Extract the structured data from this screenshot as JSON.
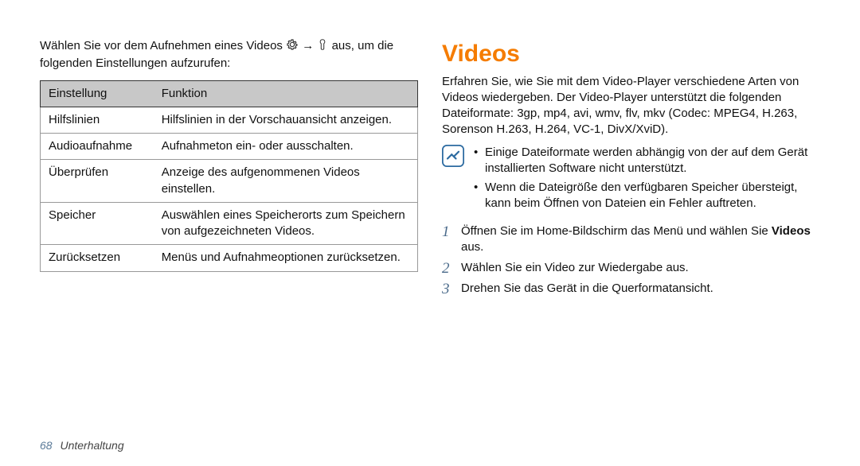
{
  "left": {
    "intro_before": "Wählen Sie vor dem Aufnehmen eines Videos ",
    "intro_after": " aus, um die folgenden Einstellungen aufzurufen:",
    "arrow": "→",
    "table": {
      "head_setting": "Einstellung",
      "head_function": "Funktion",
      "rows": [
        {
          "setting": "Hilfslinien",
          "function": "Hilfslinien in der Vorschauansicht anzeigen."
        },
        {
          "setting": "Audioaufnahme",
          "function": "Aufnahmeton ein- oder ausschalten."
        },
        {
          "setting": "Überprüfen",
          "function": "Anzeige des aufgenommenen Videos einstellen."
        },
        {
          "setting": "Speicher",
          "function": "Auswählen eines Speicherorts zum Speichern von aufgezeichneten Videos."
        },
        {
          "setting": "Zurücksetzen",
          "function": "Menüs und Aufnahmeoptionen zurücksetzen."
        }
      ]
    }
  },
  "right": {
    "heading": "Videos",
    "body": "Erfahren Sie, wie Sie mit dem Video-Player verschiedene Arten von Videos wiedergeben. Der Video-Player unterstützt die folgenden Dateiformate: 3gp, mp4, avi, wmv, flv, mkv (Codec: MPEG4, H.263, Sorenson H.263, H.264, VC-1, DivX/XviD).",
    "notes": [
      "Einige Dateiformate werden abhängig von der auf dem Gerät installierten Software nicht unterstützt.",
      "Wenn die Dateigröße den verfügbaren Speicher übersteigt, kann beim Öffnen von Dateien ein Fehler auftreten."
    ],
    "steps": {
      "s1_before": "Öffnen Sie im Home-Bildschirm das Menü und wählen Sie ",
      "s1_bold": "Videos",
      "s1_after": " aus.",
      "s2": "Wählen Sie ein Video zur Wiedergabe aus.",
      "s3": "Drehen Sie das Gerät in die Querformatansicht."
    },
    "nums": {
      "n1": "1",
      "n2": "2",
      "n3": "3"
    }
  },
  "footer": {
    "page": "68",
    "section": "Unterhaltung"
  }
}
